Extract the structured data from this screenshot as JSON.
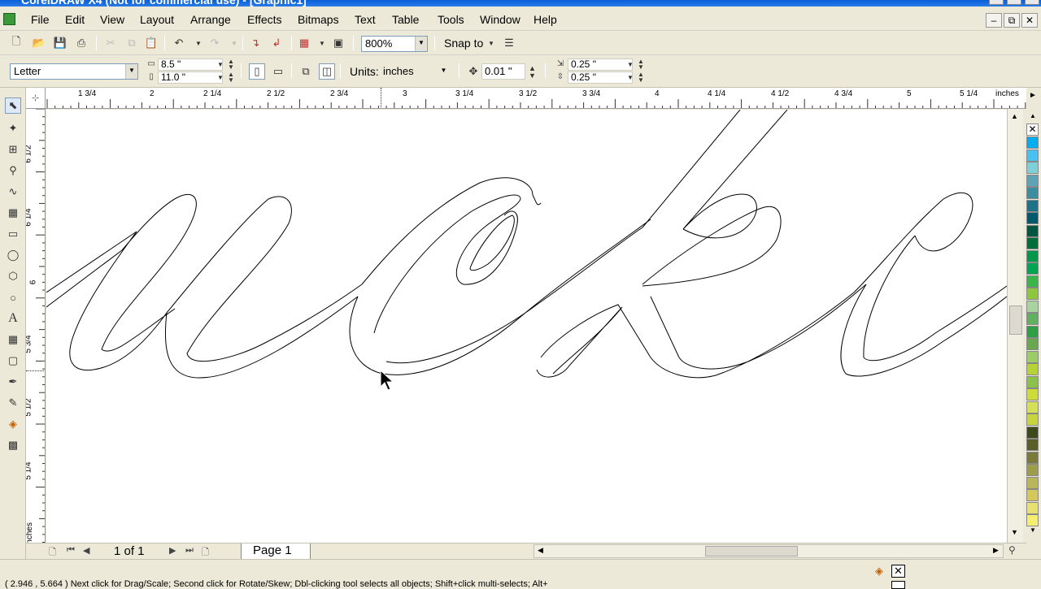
{
  "window": {
    "title": "CorelDRAW X4 (Not for commercial use) - [Graphic1]"
  },
  "menu": [
    "File",
    "Edit",
    "View",
    "Layout",
    "Arrange",
    "Effects",
    "Bitmaps",
    "Text",
    "Table",
    "Tools",
    "Window",
    "Help"
  ],
  "toolbar": {
    "zoom": "800%",
    "snap_label": "Snap to"
  },
  "property_bar": {
    "paper_size": "Letter",
    "width": "8.5 \"",
    "height": "11.0 \"",
    "units_label": "Units:",
    "units_value": "inches",
    "nudge": "0.01 \"",
    "dup_x": "0.25 \"",
    "dup_y": "0.25 \""
  },
  "ruler": {
    "h_ticks": [
      "1 3/4",
      "2",
      "2 1/4",
      "2 1/2",
      "2 3/4",
      "3",
      "3 1/4",
      "3 1/2",
      "3 3/4",
      "4",
      "4 1/4",
      "4 1/2",
      "4 3/4",
      "5",
      "5 1/4"
    ],
    "unit": "inches",
    "v_ticks": [
      "6 1/2",
      "6 1/4",
      "6",
      "5 3/4",
      "5 1/2",
      "5 1/4"
    ],
    "v_unit": "inches"
  },
  "document": {
    "page_count": "1 of 1",
    "page_tab": "Page 1"
  },
  "status": {
    "text": "( 2.946 , 5.664 )    Next click for Drag/Scale; Second click for Rotate/Skew; Dbl-clicking tool selects all objects; Shift+click multi-selects; Alt+"
  },
  "palette_colors": [
    "#00aeef",
    "#48c1f1",
    "#7fcfd9",
    "#5da3b5",
    "#3a8ea0",
    "#1d7489",
    "#005a6e",
    "#00573f",
    "#006e3b",
    "#00994c",
    "#00a651",
    "#39b54a",
    "#8dc63f",
    "#a7d4a0",
    "#5fb060",
    "#2f9e44",
    "#6aa84f",
    "#9ccc65",
    "#b5d334",
    "#8bc34a",
    "#cddc39",
    "#d4e157",
    "#c6d63c",
    "#3e4a1c",
    "#5a5f2a",
    "#7a7a3a",
    "#9c9c4a",
    "#b8b85a",
    "#d4c85a",
    "#e8e070",
    "#f4ee70"
  ]
}
